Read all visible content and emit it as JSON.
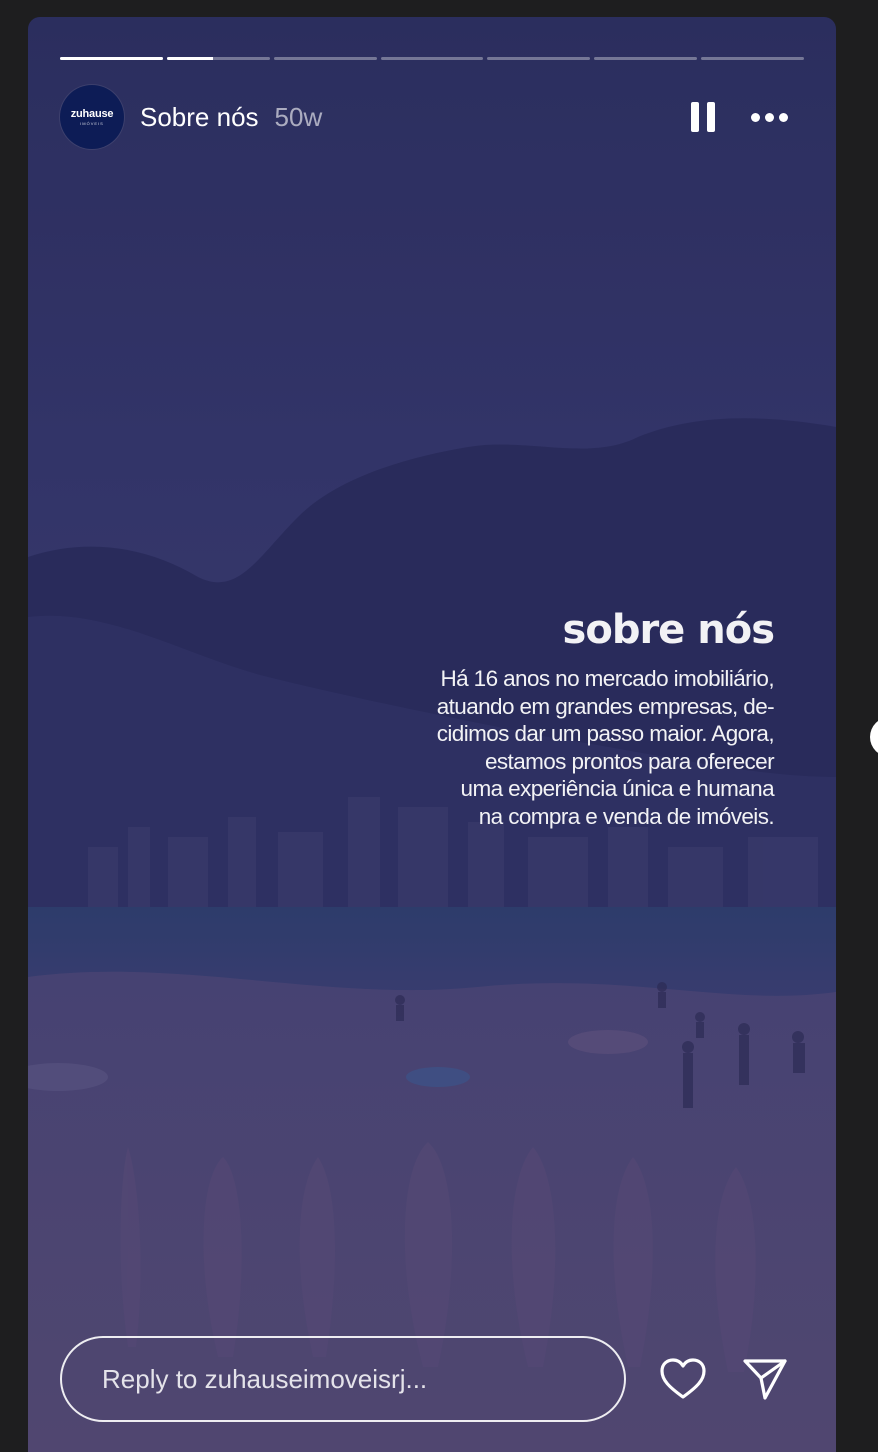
{
  "story": {
    "title": "Sobre nós",
    "time": "50w",
    "avatar_brand": "zuhause",
    "avatar_sub": "IMÓVEIS",
    "progress": [
      1,
      0.45,
      0,
      0,
      0,
      0,
      0
    ],
    "pause_icon": "pause-icon",
    "more_icon": "more-dots-icon"
  },
  "content": {
    "heading": "sobre nós",
    "lines": [
      "Há 16 anos no mercado imobiliário,",
      "atuando em grandes empresas, de-",
      "cidimos dar um passo maior. Agora,",
      "estamos prontos para oferecer",
      "uma experiência única e humana",
      "na compra e venda de imóveis."
    ]
  },
  "footer": {
    "reply_placeholder": "Reply to zuhauseimoveisrj...",
    "like_icon": "heart-icon",
    "share_icon": "send-icon"
  }
}
